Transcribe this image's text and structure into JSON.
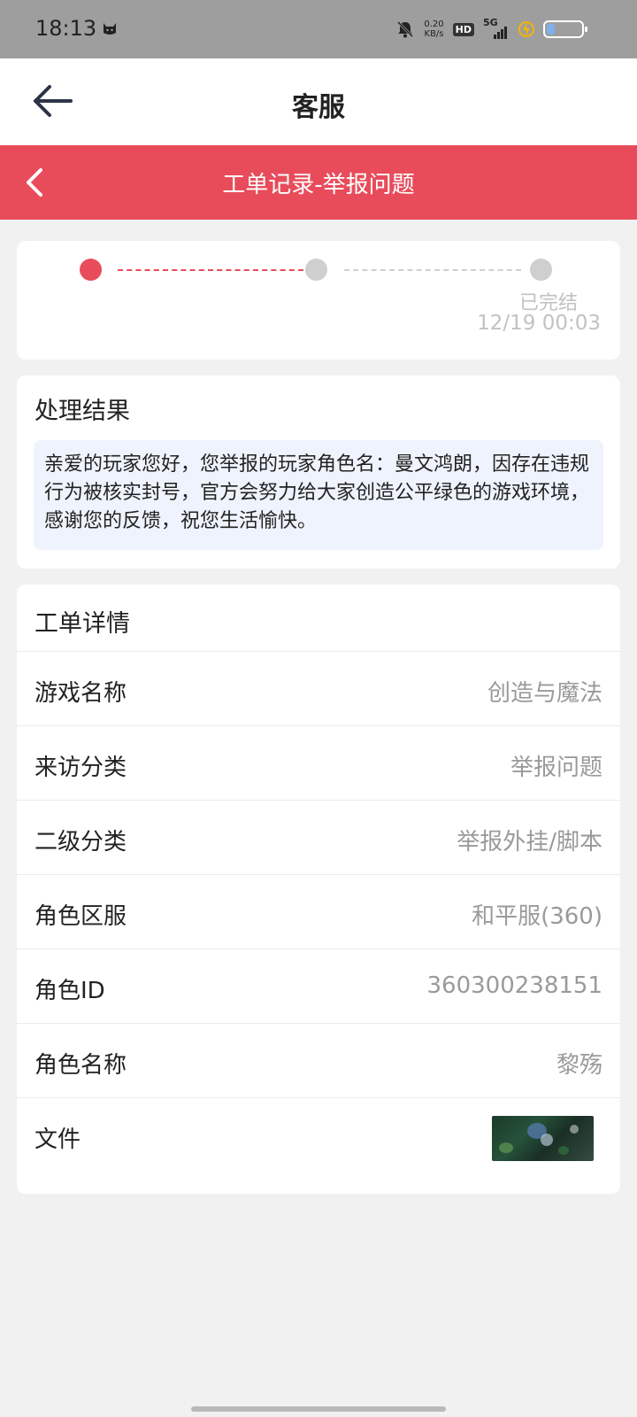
{
  "status_bar": {
    "time": "18:13",
    "net_speed_value": "0.20",
    "net_speed_unit": "KB/s",
    "hd": "HD",
    "signal": "5G",
    "battery_level": 0.3,
    "icons": [
      "cat-icon",
      "bell-off-icon",
      "signal-icon",
      "charging-icon",
      "battery-icon"
    ]
  },
  "app_bar": {
    "title": "客服",
    "back_icon": "arrow-left-icon"
  },
  "sub_header": {
    "title": "工单记录-举报问题",
    "back_icon": "chevron-left-icon",
    "color": "#e84c5b"
  },
  "progress": {
    "steps": 3,
    "current_step": 1,
    "final_label": "已完结",
    "final_time": "12/19 00:03",
    "active_color": "#e84c5b",
    "inactive_color": "#cfcfcf"
  },
  "result": {
    "title": "处理结果",
    "text": "亲爱的玩家您好，您举报的玩家角色名：曼文鸿朗，因存在违规行为被核实封号，官方会努力给大家创造公平绿色的游戏环境，感谢您的反馈，祝您生活愉快。"
  },
  "details": {
    "title": "工单详情",
    "rows": [
      {
        "label": "游戏名称",
        "value": "创造与魔法"
      },
      {
        "label": "来访分类",
        "value": "举报问题"
      },
      {
        "label": "二级分类",
        "value": "举报外挂/脚本"
      },
      {
        "label": "角色区服",
        "value": "和平服(360)"
      },
      {
        "label": "角色ID",
        "value": "360300238151"
      },
      {
        "label": "角色名称",
        "value": "黎殇"
      },
      {
        "label": "文件",
        "value": ""
      }
    ]
  }
}
